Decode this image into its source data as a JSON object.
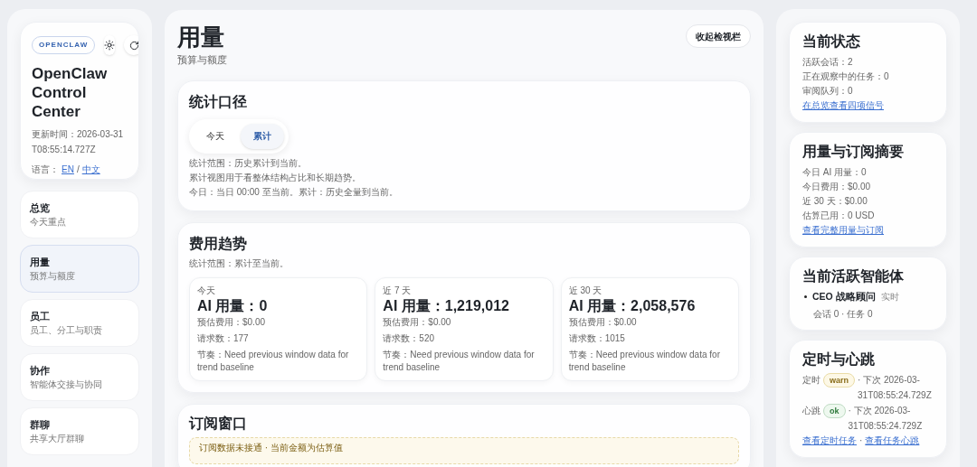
{
  "sidebar": {
    "badge": "OPENCLAW",
    "title": "OpenClaw Control Center",
    "updated": "更新时间：2026-03-31T08:55:14.727Z",
    "language_label": "语言：",
    "languages": [
      "EN",
      "中文"
    ],
    "separator": "/",
    "nav_items": [
      {
        "title": "总览",
        "subtitle": "今天重点",
        "selected": false
      },
      {
        "title": "用量",
        "subtitle": "预算与额度",
        "selected": true
      },
      {
        "title": "员工",
        "subtitle": "员工、分工与职责",
        "selected": false
      },
      {
        "title": "协作",
        "subtitle": "智能体交接与协同",
        "selected": false
      },
      {
        "title": "群聊",
        "subtitle": "共享大厅群聊",
        "selected": false
      }
    ]
  },
  "main": {
    "title": "用量",
    "subtitle": "预算与额度",
    "collapse_button": "收起检视栏",
    "scope_card": {
      "title": "统计口径",
      "toggles": [
        {
          "label": "今天",
          "selected": false
        },
        {
          "label": "累计",
          "selected": true
        }
      ],
      "notes": [
        "统计范围：历史累计到当前。",
        "累计视图用于看整体结构占比和长期趋势。",
        "今日：当日 00:00 至当前。累计：历史全量到当前。"
      ]
    },
    "trend_card": {
      "title": "费用趋势",
      "scope": "统计范围：累计至当前。",
      "stats": [
        {
          "period": "今天",
          "usage": "AI 用量：0",
          "cost": "预估费用：$0.00",
          "requests": "请求数：177",
          "rhythm": "节奏：Need previous window data for trend baseline"
        },
        {
          "period": "近 7 天",
          "usage": "AI 用量：1,219,012",
          "cost": "预估费用：$0.00",
          "requests": "请求数：520",
          "rhythm": "节奏：Need previous window data for trend baseline"
        },
        {
          "period": "近 30 天",
          "usage": "AI 用量：2,058,576",
          "cost": "预估费用：$0.00",
          "requests": "请求数：1015",
          "rhythm": "节奏：Need previous window data for trend baseline"
        }
      ]
    },
    "subscription_card": {
      "title": "订阅窗口",
      "notice": "订阅数据未接通 · 当前金额为估算值"
    }
  },
  "inspector": {
    "status": {
      "title": "当前状态",
      "lines": [
        "活跃会话：2",
        "正在观察中的任务：0",
        "审阅队列：0"
      ],
      "link": "在总览查看四项信号"
    },
    "usage": {
      "title": "用量与订阅摘要",
      "lines": [
        "今日 AI 用量：0",
        "今日费用：$0.00",
        "近 30 天：$0.00",
        "估算已用：0 USD"
      ],
      "link": "查看完整用量与订阅"
    },
    "agents": {
      "title": "当前活跃智能体",
      "items": [
        {
          "name": "CEO 战略顾问",
          "tag": "实时",
          "meta": "会话 0 · 任务 0"
        }
      ]
    },
    "schedule": {
      "title": "定时与心跳",
      "rows": [
        {
          "label": "定时",
          "status": "warn",
          "kind": "warn",
          "next": "· 下次 2026-03-31T08:55:24.729Z"
        },
        {
          "label": "心跳",
          "status": "ok",
          "kind": "ok",
          "next": "· 下次 2026-03-31T08:55:24.729Z"
        }
      ],
      "links": [
        "查看定时任务",
        "查看任务心跳"
      ],
      "link_separator": "·"
    }
  }
}
